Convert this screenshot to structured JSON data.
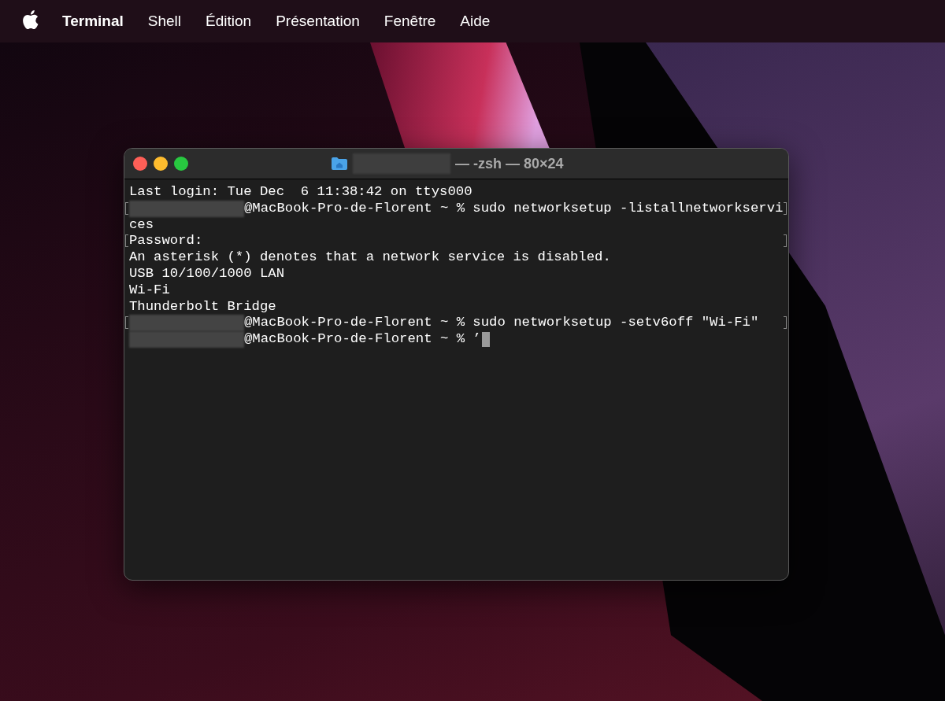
{
  "menu_bar": {
    "items": [
      {
        "label": "Terminal",
        "kind": "app"
      },
      {
        "label": "Shell",
        "kind": "menu"
      },
      {
        "label": "Édition",
        "kind": "menu"
      },
      {
        "label": "Présentation",
        "kind": "menu"
      },
      {
        "label": "Fenêtre",
        "kind": "menu"
      },
      {
        "label": "Aide",
        "kind": "menu"
      }
    ]
  },
  "window": {
    "title": "— -zsh — 80×24",
    "title_redacted": true,
    "lines": [
      {
        "text": "Last login: Tue Dec  6 11:38:42 on ttys000"
      },
      {
        "text": "@MacBook-Pro-de-Florent ~ % sudo networksetup -listallnetworkservi",
        "redacted": true,
        "marked": true
      },
      {
        "text": "ces"
      },
      {
        "text": "Password:",
        "marked": true
      },
      {
        "text": "An asterisk (*) denotes that a network service is disabled."
      },
      {
        "text": "USB 10/100/1000 LAN"
      },
      {
        "text": "Wi-Fi"
      },
      {
        "text": "Thunderbolt Bridge"
      },
      {
        "text": "@MacBook-Pro-de-Florent ~ % sudo networksetup -setv6off \"Wi-Fi\"",
        "redacted": true,
        "marked": true
      },
      {
        "text": "@MacBook-Pro-de-Florent ~ % ’",
        "redacted": true,
        "cursor": true
      }
    ]
  }
}
